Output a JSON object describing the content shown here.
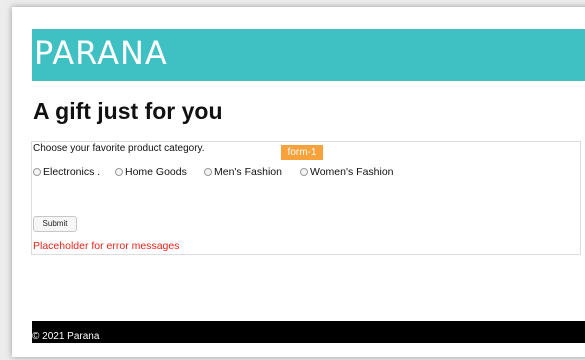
{
  "brand": {
    "logo": "PARANA",
    "banner_color": "#3fc0c3"
  },
  "main": {
    "heading": "A gift just for you"
  },
  "form": {
    "tag": "form-1",
    "tag_color": "#f7a23b",
    "question": "Choose your favorite product category.",
    "options": [
      {
        "label": "Electronics .",
        "selected": false
      },
      {
        "label": "Home Goods",
        "selected": false
      },
      {
        "label": "Men's Fashion",
        "selected": false
      },
      {
        "label": "Women's Fashion",
        "selected": false
      }
    ],
    "submit_label": "Submit",
    "error_message": "Placeholder for error messages",
    "error_color": "#e8241b"
  },
  "footer": {
    "text": "© 2021 Parana"
  }
}
